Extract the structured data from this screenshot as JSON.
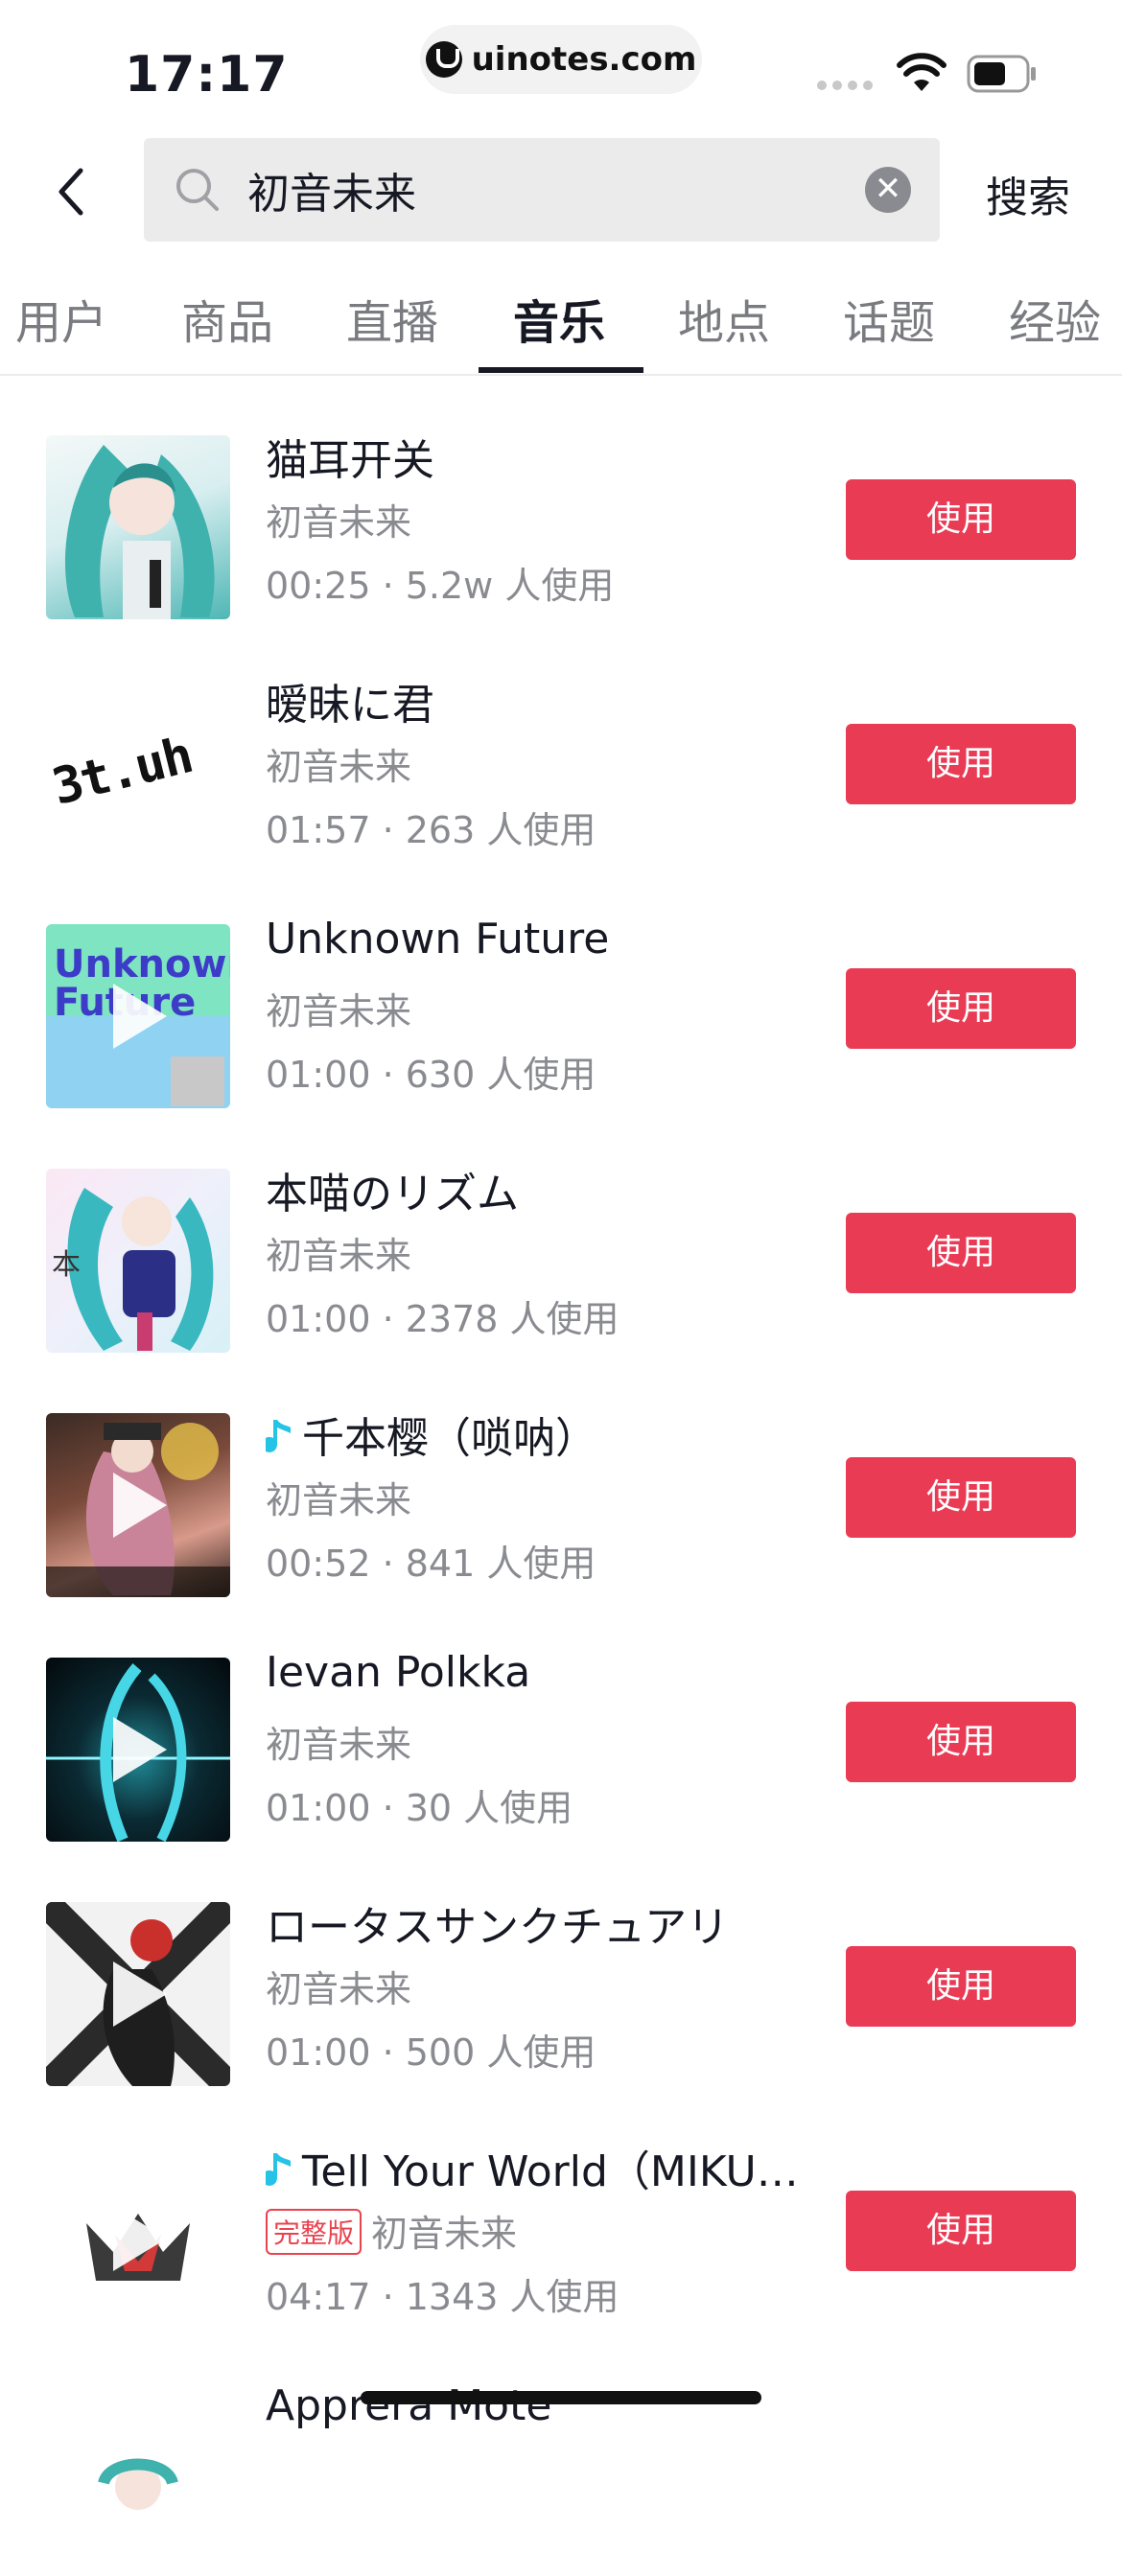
{
  "status": {
    "time": "17:17",
    "url": "uinotes.com"
  },
  "search": {
    "query": "初音未来",
    "submit_label": "搜索"
  },
  "tabs": [
    {
      "label": "用户"
    },
    {
      "label": "商品"
    },
    {
      "label": "直播"
    },
    {
      "label": "音乐"
    },
    {
      "label": "地点"
    },
    {
      "label": "话题"
    },
    {
      "label": "经验"
    }
  ],
  "active_tab": "音乐",
  "songs": [
    {
      "title": "猫耳开关",
      "artist": "初音未来",
      "meta": "00:25 · 5.2w 人使用",
      "use_label": "使用"
    },
    {
      "title": "暧昧に君",
      "artist": "初音未来",
      "meta": "01:57 · 263 人使用",
      "use_label": "使用"
    },
    {
      "title": "Unknown Future",
      "artist": "初音未来",
      "meta": "01:00 · 630 人使用",
      "use_label": "使用"
    },
    {
      "title": "本喵のリズム",
      "artist": "初音未来",
      "meta": "01:00 · 2378 人使用",
      "use_label": "使用"
    },
    {
      "title": "千本樱（唢呐）",
      "artist": "初音未来",
      "meta": "00:52 · 841 人使用",
      "use_label": "使用"
    },
    {
      "title": "Ievan Polkka",
      "artist": "初音未来",
      "meta": "01:00 · 30 人使用",
      "use_label": "使用"
    },
    {
      "title": "ロータスサンクチュアリ",
      "artist": "初音未来",
      "meta": "01:00 · 500 人使用",
      "use_label": "使用"
    },
    {
      "title": "Tell Your World（MIKU…",
      "badge": "完整版",
      "artist": "初音未来",
      "meta": "04:17 · 1343 人使用",
      "use_label": "使用"
    },
    {
      "title": "Apprera Mote"
    }
  ],
  "cover_texts": {
    "song2": "3t.uh",
    "song3": "Unknown Future"
  },
  "colors": {
    "accent": "#ea3b55",
    "tiktok_cyan": "#25c4e6"
  }
}
